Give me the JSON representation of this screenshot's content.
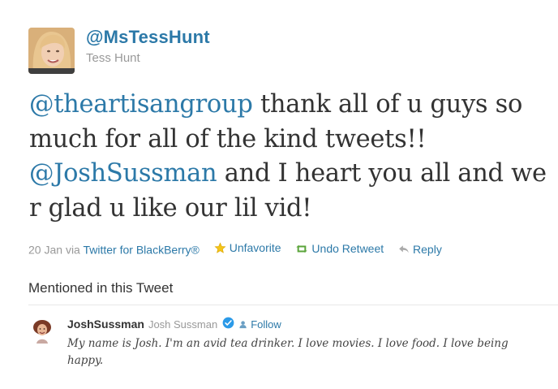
{
  "tweet": {
    "screen_name": "@MsTessHunt",
    "full_name": "Tess Hunt",
    "text_parts": {
      "mention1": "@theartisangroup",
      "t1": " thank all of u guys so much for all of the kind tweets!! ",
      "mention2": "@JoshSussman",
      "t2": " and I heart you all and we r glad u like our lil vid!"
    },
    "meta": {
      "date": "20 Jan",
      "via": "via",
      "source": "Twitter for BlackBerry®",
      "favorite_label": "Unfavorite",
      "retweet_label": "Undo Retweet",
      "reply_label": "Reply"
    }
  },
  "mentioned": {
    "heading": "Mentioned in this Tweet",
    "user": {
      "screen_name": "JoshSussman",
      "full_name": "Josh Sussman",
      "follow_label": "Follow",
      "bio": "My name is Josh. I'm an avid tea drinker. I love movies. I love food. I love being happy."
    }
  },
  "colors": {
    "link": "#2c79a8",
    "muted": "#999999",
    "text": "#333333",
    "star": "#f5c518",
    "retweet": "#5aa43a",
    "verified": "#2b9ae8"
  },
  "icons": [
    "avatar",
    "star-icon",
    "retweet-icon",
    "reply-icon",
    "verified-icon",
    "follow-icon"
  ]
}
